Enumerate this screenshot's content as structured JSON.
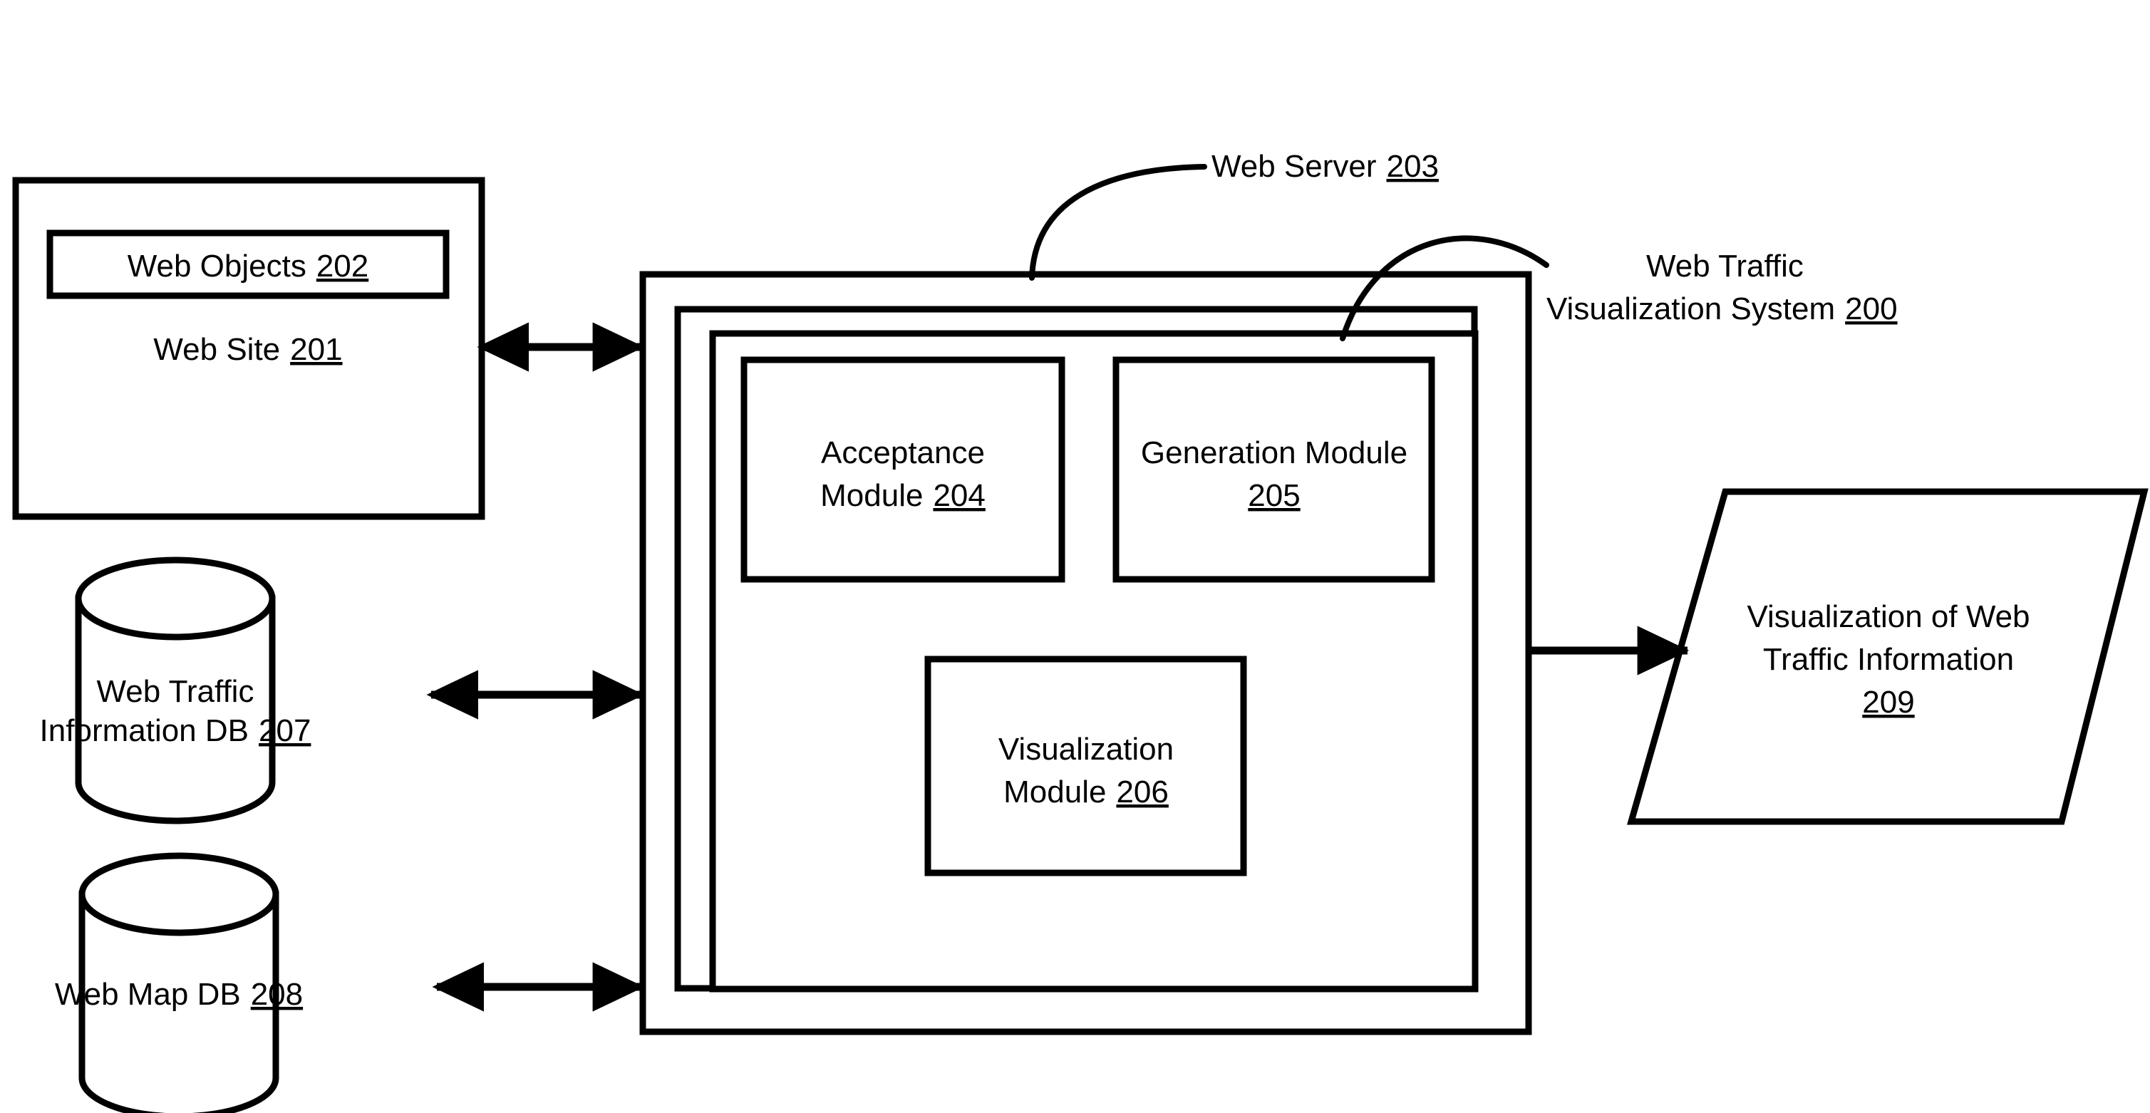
{
  "figure": {
    "title": "Web Traffic Visualization System block diagram",
    "background_color": "#ffffff",
    "line_color": "#000000"
  },
  "nodes": {
    "web_site": {
      "label": "Web Site",
      "ref": "201",
      "shape": "rectangle"
    },
    "web_objects": {
      "label": "Web Objects",
      "ref": "202",
      "shape": "rectangle"
    },
    "web_server": {
      "label": "Web Server",
      "ref": "203",
      "shape": "rectangle-callout"
    },
    "acceptance_module": {
      "line1": "Acceptance",
      "line2": "Module",
      "ref": "204",
      "shape": "rectangle"
    },
    "generation_module": {
      "line1": "Generation Module",
      "ref": "205",
      "shape": "rectangle"
    },
    "visualization_module": {
      "line1": "Visualization",
      "line2": "Module",
      "ref": "206",
      "shape": "rectangle"
    },
    "web_traffic_db": {
      "line1": "Web Traffic",
      "line2": "Information DB",
      "ref": "207",
      "shape": "cylinder"
    },
    "web_map_db": {
      "line1": "Web Map DB",
      "ref": "208",
      "shape": "cylinder"
    },
    "visualization_output": {
      "line1": "Visualization of Web",
      "line2": "Traffic Information",
      "ref": "209",
      "shape": "parallelogram"
    },
    "system": {
      "line1": "Web Traffic",
      "line2": "Visualization System",
      "ref": "200",
      "shape": "rectangle-callout"
    }
  },
  "connectors": [
    {
      "name": "web-site-to-system",
      "from": "web_site",
      "to": "system",
      "direction": "bidirectional"
    },
    {
      "name": "web-traffic-db-to-system",
      "from": "web_traffic_db",
      "to": "system",
      "direction": "bidirectional"
    },
    {
      "name": "web-map-db-to-system",
      "from": "web_map_db",
      "to": "system",
      "direction": "bidirectional"
    },
    {
      "name": "system-to-visualization-output",
      "from": "system",
      "to": "visualization_output",
      "direction": "unidirectional"
    }
  ]
}
